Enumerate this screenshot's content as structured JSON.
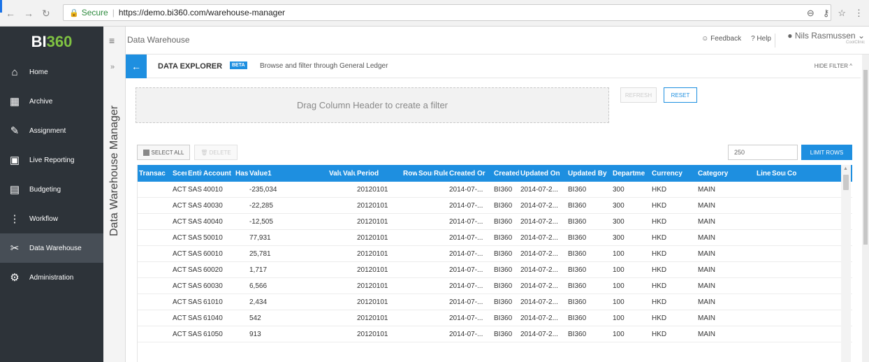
{
  "browser": {
    "secure_label": "Secure",
    "url": "https://demo.bi360.com/warehouse-manager"
  },
  "app": {
    "logo_text": "BI360",
    "header_title": "Data Warehouse",
    "feedback_label": "Feedback",
    "help_label": "Help",
    "user_name": "Nils Rasmussen",
    "user_sub": "CoolClinic"
  },
  "sidebar": {
    "items": [
      {
        "label": "Home",
        "icon": "home-icon"
      },
      {
        "label": "Archive",
        "icon": "archive-icon"
      },
      {
        "label": "Assignment",
        "icon": "assignment-icon"
      },
      {
        "label": "Live Reporting",
        "icon": "live-reporting-icon"
      },
      {
        "label": "Budgeting",
        "icon": "budgeting-icon"
      },
      {
        "label": "Workflow",
        "icon": "workflow-icon"
      },
      {
        "label": "Data Warehouse",
        "icon": "data-warehouse-icon"
      },
      {
        "label": "Administration",
        "icon": "gear-icon"
      }
    ],
    "active": "Data Warehouse"
  },
  "panel": {
    "vertical_title": "Data Warehouse Manager"
  },
  "explorer": {
    "title": "DATA EXPLORER",
    "badge": "BETA",
    "description": "Browse and filter through General Ledger",
    "hide_filter": "HIDE FILTER ^",
    "dropzone": "Drag Column Header to create a filter",
    "refresh": "REFRESH",
    "reset": "RESET",
    "select_all": "SELECT ALL",
    "delete": "DELETE",
    "row_limit": "250",
    "limit_rows": "LIMIT ROWS"
  },
  "grid": {
    "columns": [
      "Transac",
      "Scer",
      "Entit",
      "Account",
      "Has",
      "Value1",
      "Valu",
      "Valu",
      "Period",
      "Row",
      "Sour",
      "Rule",
      "Created Or",
      "Created",
      "Updated On",
      "Updated By",
      "Departme",
      "Currency",
      "Category",
      "Line",
      "Sour",
      "Co"
    ],
    "rows": [
      [
        "",
        "ACT",
        "SAS",
        "40010",
        "",
        "-235,034",
        "",
        "",
        "20120101",
        "",
        "",
        "",
        "2014-07-...",
        "BI360",
        "2014-07-2...",
        "BI360",
        "300",
        "HKD",
        "MAIN",
        "",
        "",
        ""
      ],
      [
        "",
        "ACT",
        "SAS",
        "40030",
        "",
        "-22,285",
        "",
        "",
        "20120101",
        "",
        "",
        "",
        "2014-07-...",
        "BI360",
        "2014-07-2...",
        "BI360",
        "300",
        "HKD",
        "MAIN",
        "",
        "",
        ""
      ],
      [
        "",
        "ACT",
        "SAS",
        "40040",
        "",
        "-12,505",
        "",
        "",
        "20120101",
        "",
        "",
        "",
        "2014-07-...",
        "BI360",
        "2014-07-2...",
        "BI360",
        "300",
        "HKD",
        "MAIN",
        "",
        "",
        ""
      ],
      [
        "",
        "ACT",
        "SAS",
        "50010",
        "",
        "77,931",
        "",
        "",
        "20120101",
        "",
        "",
        "",
        "2014-07-...",
        "BI360",
        "2014-07-2...",
        "BI360",
        "300",
        "HKD",
        "MAIN",
        "",
        "",
        ""
      ],
      [
        "",
        "ACT",
        "SAS",
        "60010",
        "",
        "25,781",
        "",
        "",
        "20120101",
        "",
        "",
        "",
        "2014-07-...",
        "BI360",
        "2014-07-2...",
        "BI360",
        "100",
        "HKD",
        "MAIN",
        "",
        "",
        ""
      ],
      [
        "",
        "ACT",
        "SAS",
        "60020",
        "",
        "1,717",
        "",
        "",
        "20120101",
        "",
        "",
        "",
        "2014-07-...",
        "BI360",
        "2014-07-2...",
        "BI360",
        "100",
        "HKD",
        "MAIN",
        "",
        "",
        ""
      ],
      [
        "",
        "ACT",
        "SAS",
        "60030",
        "",
        "6,566",
        "",
        "",
        "20120101",
        "",
        "",
        "",
        "2014-07-...",
        "BI360",
        "2014-07-2...",
        "BI360",
        "100",
        "HKD",
        "MAIN",
        "",
        "",
        ""
      ],
      [
        "",
        "ACT",
        "SAS",
        "61010",
        "",
        "2,434",
        "",
        "",
        "20120101",
        "",
        "",
        "",
        "2014-07-...",
        "BI360",
        "2014-07-2...",
        "BI360",
        "100",
        "HKD",
        "MAIN",
        "",
        "",
        ""
      ],
      [
        "",
        "ACT",
        "SAS",
        "61040",
        "",
        "542",
        "",
        "",
        "20120101",
        "",
        "",
        "",
        "2014-07-...",
        "BI360",
        "2014-07-2...",
        "BI360",
        "100",
        "HKD",
        "MAIN",
        "",
        "",
        ""
      ],
      [
        "",
        "ACT",
        "SAS",
        "61050",
        "",
        "913",
        "",
        "",
        "20120101",
        "",
        "",
        "",
        "2014-07-...",
        "BI360",
        "2014-07-2...",
        "BI360",
        "100",
        "HKD",
        "MAIN",
        "",
        "",
        ""
      ]
    ]
  },
  "colors": {
    "accent": "#1e8fe0",
    "sidebar_bg": "#2d3339",
    "logo_green": "#7fc242"
  }
}
